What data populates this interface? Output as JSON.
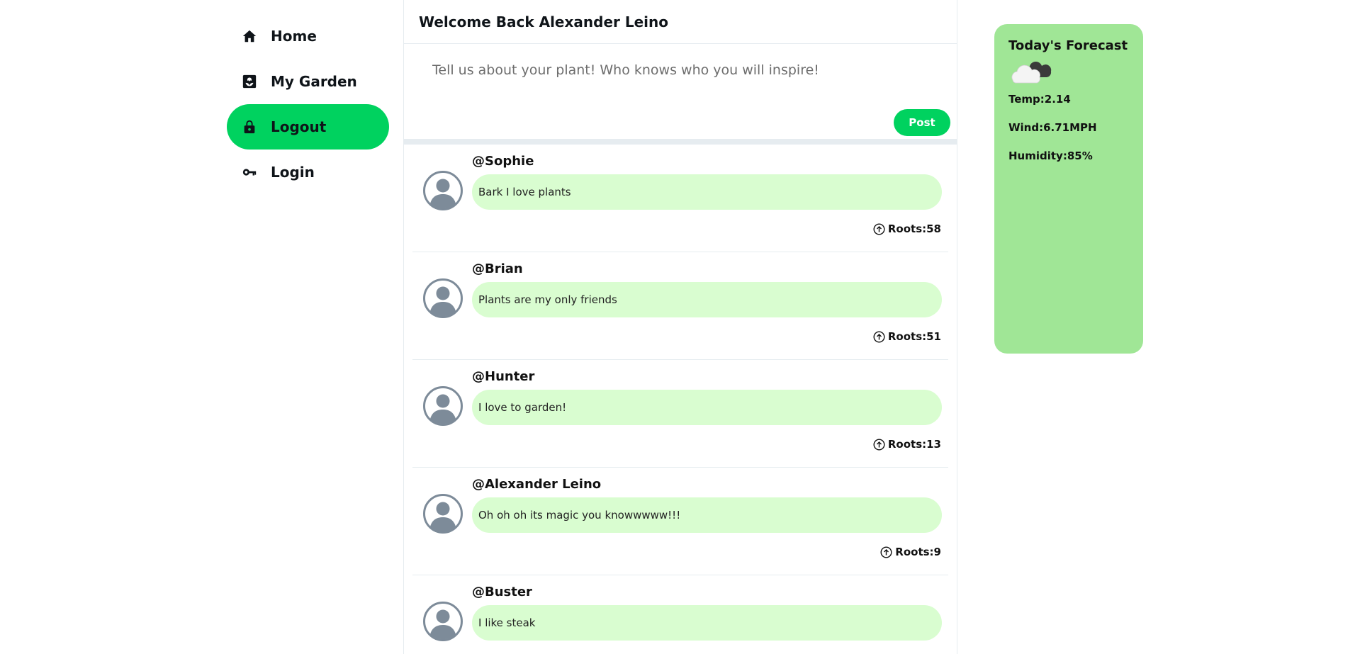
{
  "sidebar": {
    "items": [
      {
        "label": "Home",
        "icon": "home-icon",
        "active": false
      },
      {
        "label": "My Garden",
        "icon": "garden-icon",
        "active": false
      },
      {
        "label": "Logout",
        "icon": "lock-icon",
        "active": true
      },
      {
        "label": "Login",
        "icon": "key-icon",
        "active": false
      }
    ],
    "accent_color": "#00d25f"
  },
  "header": {
    "title": "Welcome Back Alexander Leino"
  },
  "composer": {
    "placeholder": "Tell us about your plant! Who knows who you will inspire!",
    "value": "",
    "post_label": "Post"
  },
  "posts": [
    {
      "user": "@Sophie",
      "text": "Bark I love plants",
      "roots": "Roots:58"
    },
    {
      "user": "@Brian",
      "text": "Plants are my only friends",
      "roots": "Roots:51"
    },
    {
      "user": "@Hunter",
      "text": "I love to garden!",
      "roots": "Roots:13"
    },
    {
      "user": "@Alexander Leino",
      "text": "Oh oh oh its magic you knowwwww!!!",
      "roots": "Roots:9"
    },
    {
      "user": "@Buster",
      "text": "I like steak",
      "roots": ""
    }
  ],
  "forecast": {
    "title": "Today's Forecast",
    "icon": "cloud-icon",
    "temp": "Temp:2.14",
    "wind": "Wind:6.71MPH",
    "humidity": "Humidity:85%",
    "background_color": "#a0e696"
  },
  "colors": {
    "bubble": "#d9fdd0",
    "post_button": "#00d25f"
  }
}
